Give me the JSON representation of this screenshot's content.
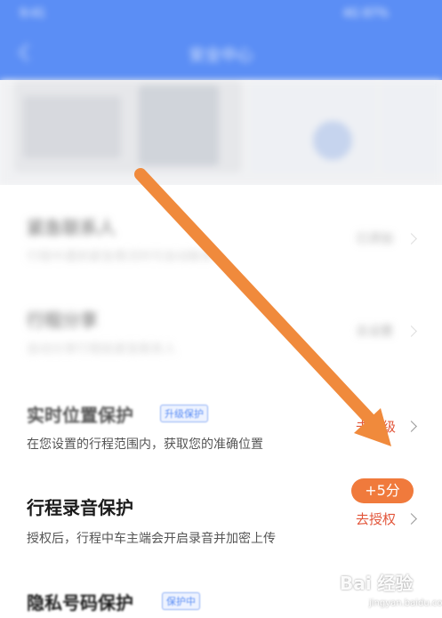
{
  "header": {
    "title": "安全中心",
    "status_time": "9:41",
    "status_right": "4G 87%"
  },
  "sections": {
    "emergency": {
      "title": "紧急联系人",
      "desc": "行程中遇到紧急情况时可自动联系",
      "action": "已添加"
    },
    "share": {
      "title": "行程分享",
      "desc": "自动分享行程给紧急联系人",
      "action": "去设置"
    },
    "location": {
      "title": "实时位置保护",
      "badge": "升级保护",
      "desc": "在您设置的行程范围内，获取您的准确位置",
      "action": "去升级"
    },
    "recording": {
      "title": "行程录音保护",
      "desc": "授权后，行程中车主端会开启录音并加密上传",
      "points": "+5分",
      "action": "去授权"
    },
    "privacy": {
      "title": "隐私号码保护",
      "badge": "保护中"
    }
  },
  "watermark": {
    "brand": "Bai 经验",
    "url": "jingyan.baidu.com"
  },
  "colors": {
    "header_blue": "#5b8ef5",
    "accent_orange": "#f07a3c",
    "action_red": "#e2553a",
    "badge_blue": "#5b8ef5"
  }
}
